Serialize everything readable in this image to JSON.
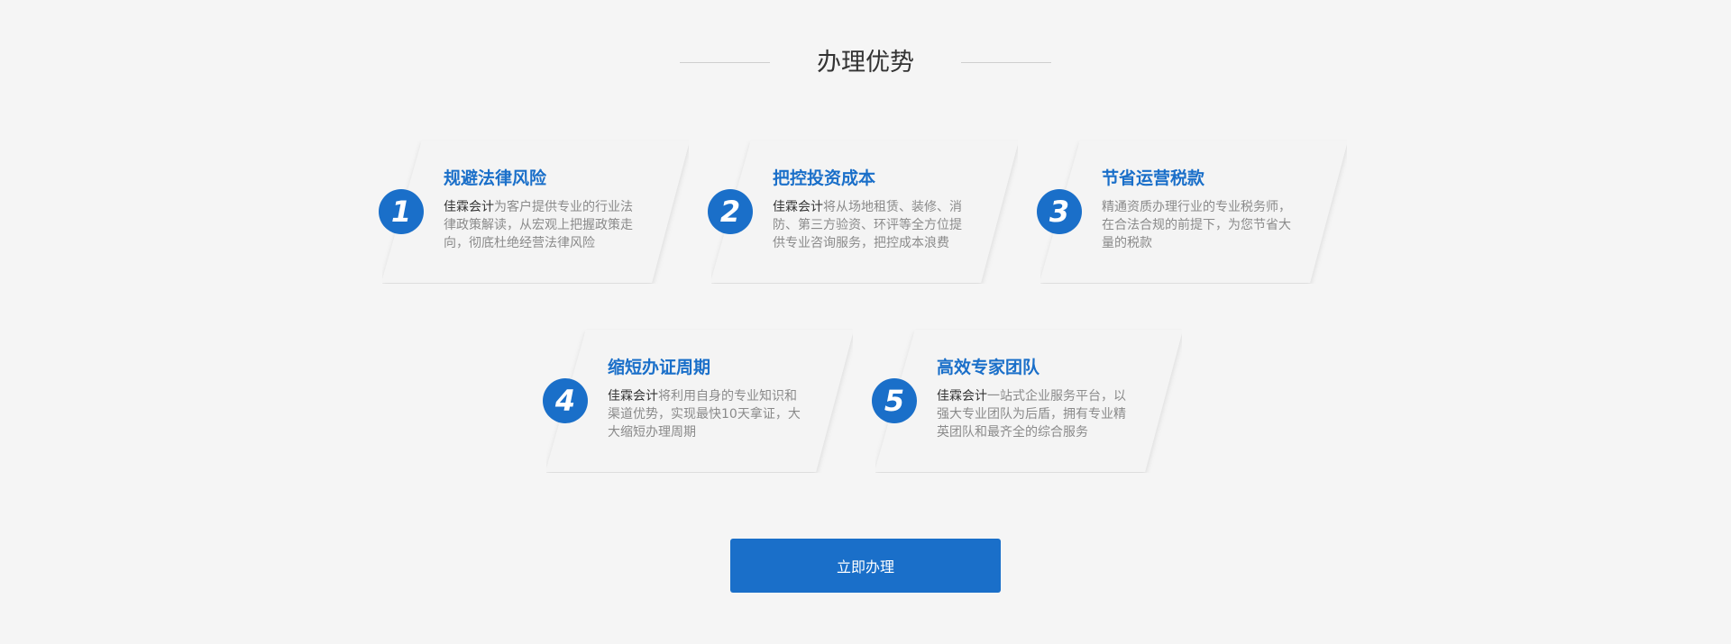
{
  "section": {
    "title": "办理优势"
  },
  "cards": [
    {
      "number": "1",
      "title": "规避法律风险",
      "brand": "佳霖会计",
      "text": "为客户提供专业的行业法律政策解读，从宏观上把握政策走向，彻底杜绝经营法律风险"
    },
    {
      "number": "2",
      "title": "把控投资成本",
      "brand": "佳霖会计",
      "text": "将从场地租赁、装修、消防、第三方验资、环评等全方位提供专业咨询服务，把控成本浪费"
    },
    {
      "number": "3",
      "title": "节省运营税款",
      "brand": "",
      "text": "精通资质办理行业的专业税务师，在合法合规的前提下，为您节省大量的税款"
    },
    {
      "number": "4",
      "title": "缩短办证周期",
      "brand": "佳霖会计",
      "text": "将利用自身的专业知识和渠道优势，实现最快10天拿证，大大缩短办理周期"
    },
    {
      "number": "5",
      "title": "高效专家团队",
      "brand": "佳霖会计",
      "text": "一站式企业服务平台，以强大专业团队为后盾，拥有专业精英团队和最齐全的综合服务"
    }
  ],
  "cta": {
    "label": "立即办理"
  },
  "colors": {
    "accent": "#1a6fc9",
    "background": "#f5f5f5",
    "card": "#f4f4f4",
    "title_text": "#333333",
    "body_text": "#8a8a8a"
  }
}
